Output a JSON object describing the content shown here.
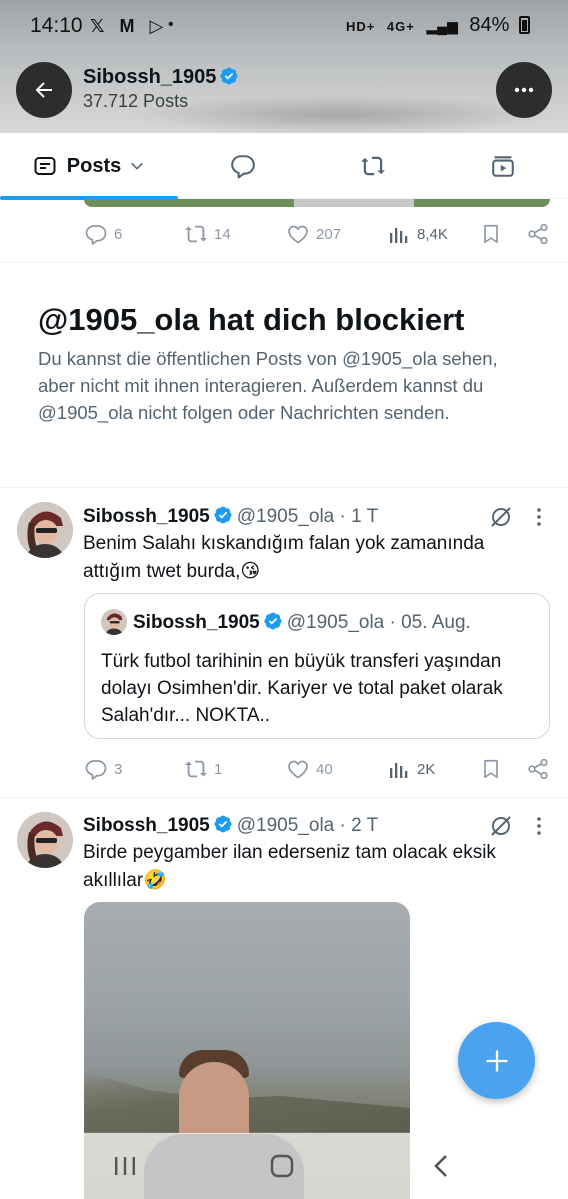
{
  "status_bar": {
    "time": "14:10",
    "left_icons": "𝕏 M ▷",
    "dot": "•",
    "signal_label": "4G+",
    "hd_label": "HD+",
    "battery": "84%"
  },
  "header": {
    "name": "Sibossh_1905",
    "post_count": "37.712 Posts"
  },
  "tabs": {
    "posts_label": "Posts"
  },
  "top_post_actions": {
    "replies": "6",
    "reposts": "14",
    "likes": "207",
    "views": "8,4K"
  },
  "block_notice": {
    "title": "@1905_ola hat dich blockiert",
    "text": "Du kannst die öffentlichen Posts von @1905_ola sehen, aber nicht mit ihnen interagieren. Außerdem kannst du @1905_ola nicht folgen oder Nachrichten senden."
  },
  "tweets": [
    {
      "name": "Sibossh_1905",
      "handle": "@1905_ola · 1 T",
      "text": "Benim Salahı kıskandığım falan yok zamanında attığım twet burda,😘",
      "quote": {
        "name": "Sibossh_1905",
        "handle": "@1905_ola · 05. Aug.",
        "text": "Türk futbol tarihinin en büyük transferi yaşından dolayı Osimhen'dir. Kariyer ve total paket olarak Salah'dır... NOKTA.."
      },
      "replies": "3",
      "reposts": "1",
      "likes": "40",
      "views": "2K"
    },
    {
      "name": "Sibossh_1905",
      "handle": "@1905_ola · 2 T",
      "text": "Birde peygamber ilan ederseniz tam olacak eksik akıllılar🤣"
    }
  ],
  "colors": {
    "accent": "#1d9bf0",
    "fab": "#4aa3ee",
    "secondary_text": "#536471"
  }
}
